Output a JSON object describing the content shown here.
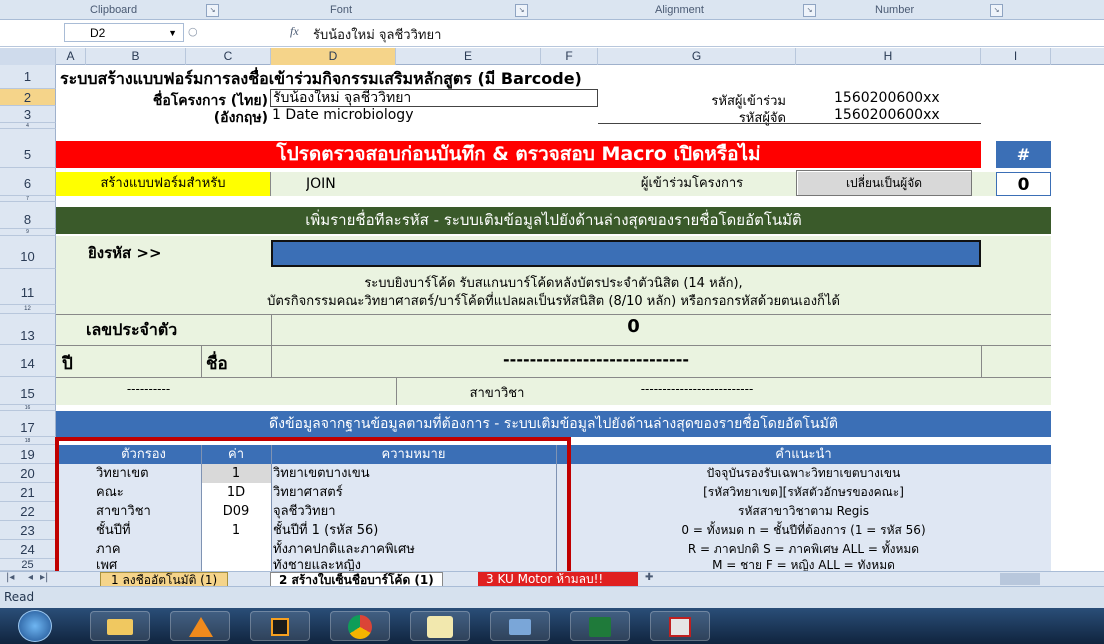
{
  "ribbon": {
    "groups": [
      "Clipboard",
      "Font",
      "Alignment",
      "Number"
    ]
  },
  "formula_bar": {
    "cell_ref": "D2",
    "fx": "fx",
    "content": "รับน้องใหม่  จุลชีววิทยา"
  },
  "columns": [
    "A",
    "B",
    "C",
    "D",
    "E",
    "F",
    "G",
    "H",
    "I"
  ],
  "row_numbers": [
    "1",
    "2",
    "3",
    "4",
    "5",
    "6",
    "7",
    "8",
    "9",
    "10",
    "11",
    "12",
    "13",
    "14",
    "15",
    "16",
    "17",
    "18",
    "19",
    "20",
    "21",
    "22",
    "23",
    "24",
    "25"
  ],
  "sheet": {
    "title": "ระบบสร้างแบบฟอร์มการลงชื่อเข้าร่วมกิจกรรมเสริมหลักสูตร (มี Barcode)",
    "project_th_label": "ชื่อโครงการ (ไทย)",
    "project_th_value": "รับน้องใหม่ จุลชีววิทยา",
    "participant_code_label": "รหัสผู้เข้าร่วม",
    "participant_code_value": "1560200600xx",
    "project_en_label": "(อังกฤษ)",
    "project_en_value": "1 Date microbiology",
    "organizer_code_label": "รหัสผู้จัด",
    "organizer_code_value": "1560200600xx",
    "warning_banner": "โปรดตรวจสอบก่อนบันทึก & ตรวจสอบ Macro เปิดหรือไม่",
    "hash": "#",
    "create_for_label": "สร้างแบบฟอร์มสำหรับ",
    "join_value": "JOIN",
    "participant_project": "ผู้เข้าร่วมโครงการ",
    "switch_button": "เปลี่ยนเป็นผู้จัด",
    "counter": "0",
    "add_section_header": "เพิ่มรายชื่อทีละรหัส - ระบบเติมข้อมูลไปยังด้านล่างสุดของรายชื่อโดยอัตโนมัติ",
    "scan_label": "ยิงรหัส >>",
    "scan_value": "",
    "scan_note_1": "ระบบยิงบาร์โค้ด รับสแกนบาร์โค้ดหลังบัตรประจำตัวนิสิต (14 หลัก),",
    "scan_note_2": "บัตรกิจกรรมคณะวิทยาศาสตร์/บาร์โค้ดที่แปลผลเป็นรหัสนิสิต (8/10 หลัก) หรือกรอกรหัสด้วยตนเองก็ได้",
    "id_label": "เลขประจำตัว",
    "id_value": "0",
    "year_label": "ปี",
    "name_label": "ชื่อ",
    "name_dashes": "----------------------------",
    "dashes_short": "----------",
    "major_label": "สาขาวิชา",
    "major_dashes": "--------------------------",
    "db_section_header": "ดึงข้อมูลจากฐานข้อมูลตามที่ต้องการ - ระบบเติมข้อมูลไปยังด้านล่างสุดของรายชื่อโดยอัตโนมัติ",
    "filter_headers": {
      "filter": "ตัวกรอง",
      "value": "ค่า",
      "meaning": "ความหมาย",
      "advice": "คำแนะนำ"
    },
    "filter_rows": [
      {
        "filter": "วิทยาเขต",
        "value": "1",
        "meaning": "วิทยาเขตบางเขน",
        "advice": "ปัจจุบันรองรับเฉพาะวิทยาเขตบางเขน"
      },
      {
        "filter": "คณะ",
        "value": "1D",
        "meaning": "วิทยาศาสตร์",
        "advice": "[รหัสวิทยาเขต][รหัสตัวอักษรของคณะ]"
      },
      {
        "filter": "สาขาวิชา",
        "value": "D09",
        "meaning": "จุลชีววิทยา",
        "advice": "รหัสสาขาวิชาตาม Regis"
      },
      {
        "filter": "ชั้นปีที่",
        "value": "1",
        "meaning": "ชั้นปีที่ 1 (รหัส 56)",
        "advice": "0 = ทั้งหมด n = ชั้นปีที่ต้องการ (1 = รหัส 56)"
      },
      {
        "filter": "ภาค",
        "value": "",
        "meaning": "ทั้งภาคปกติและภาคพิเศษ",
        "advice": "R = ภาคปกติ S = ภาคพิเศษ ALL = ทั้งหมด"
      },
      {
        "filter": "เพศ",
        "value": "",
        "meaning": "ทั้งชายและหญิง",
        "advice": "M = ชาย F = หญิง ALL = ทั้งหมด"
      }
    ]
  },
  "tabs": [
    "1 ลงชื่ออัตโนมัติ (1)",
    "2 สร้างใบเซ็นชื่อบาร์โค้ด (1)",
    "3 KU Motor ห้ามลบ!!"
  ],
  "status": "Read",
  "taskbar_icons": [
    "start-orb-icon",
    "file-explorer-icon",
    "vlc-icon",
    "media-player-icon",
    "chrome-icon",
    "hao123-icon",
    "network-icon",
    "excel-icon",
    "ec-app-icon"
  ],
  "colors": {
    "red_banner": "#ff0000",
    "dark_green": "#3a5a2a",
    "light_green": "#eaf3e0",
    "blue_header": "#3b6fb6",
    "yellow": "#ffff00",
    "highlight_box": "#c00000"
  }
}
